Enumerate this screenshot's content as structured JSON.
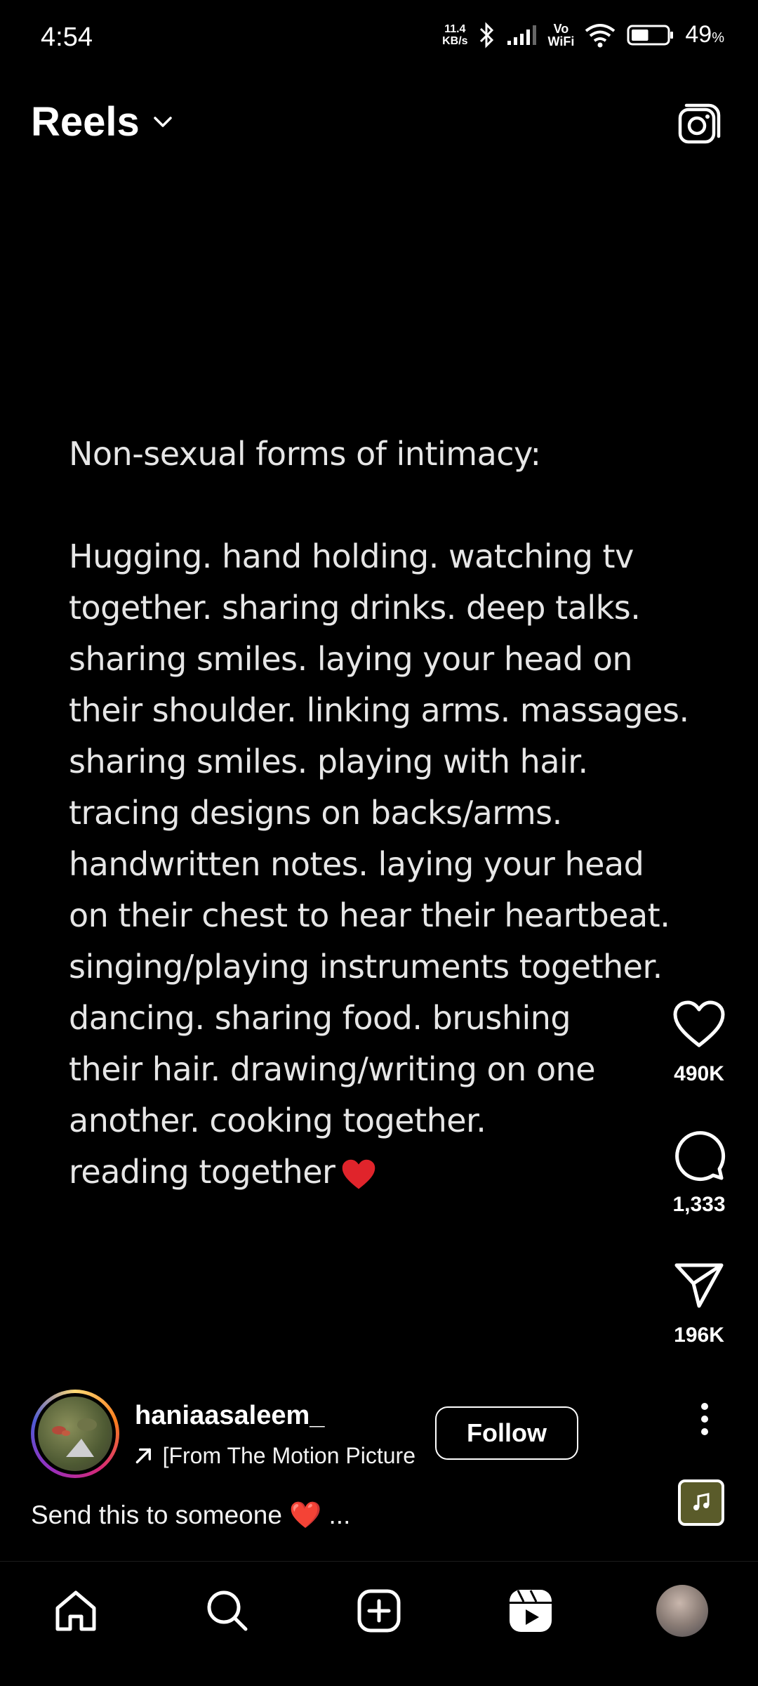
{
  "status_bar": {
    "time": "4:54",
    "net_speed_value": "11.4",
    "net_speed_unit": "KB/s",
    "vowifi_top": "Vo",
    "vowifi_bottom": "WiFi",
    "battery_percent": "49",
    "battery_symbol": "%",
    "battery_level": 0.49
  },
  "header": {
    "title": "Reels"
  },
  "reel": {
    "heading": "Non-sexual forms of intimacy:",
    "lines": [
      "Hugging. hand holding. watching tv",
      "together. sharing drinks. deep talks.",
      "sharing smiles. laying your head on",
      "their shoulder. linking arms. massages.",
      "sharing smiles. playing with hair.",
      "tracing designs on backs/arms.",
      "handwritten notes. laying your head",
      "on their chest to hear their heartbeat.",
      "singing/playing instruments together.",
      "dancing. sharing food. brushing",
      "their hair. drawing/writing on one",
      "another. cooking together.",
      "reading together"
    ]
  },
  "actions": {
    "likes": "490K",
    "comments": "1,333",
    "shares": "196K"
  },
  "post": {
    "username": "haniaasaleem_",
    "audio": "[From The Motion Picture",
    "follow_label": "Follow",
    "caption": "Send this to someone ❤️ ..."
  },
  "colors": {
    "background": "#000000",
    "text": "#ffffff",
    "heart": "#e0242b"
  },
  "icons": {
    "like": "heart-icon",
    "comment": "comment-icon",
    "share": "send-icon",
    "more": "more-vertical-icon",
    "camera": "camera-icon",
    "home": "home-icon",
    "search": "search-icon",
    "create": "create-icon",
    "reels": "reels-icon"
  }
}
